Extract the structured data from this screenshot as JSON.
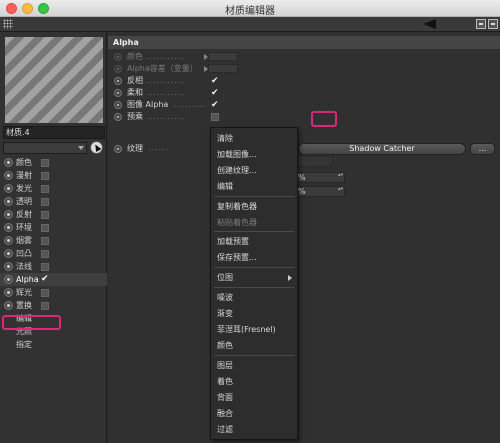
{
  "window": {
    "title": "材质编辑器"
  },
  "material": {
    "name": "材质.4"
  },
  "channels": [
    {
      "label": "颜色",
      "checked": false
    },
    {
      "label": "漫射",
      "checked": false
    },
    {
      "label": "发光",
      "checked": false
    },
    {
      "label": "透明",
      "checked": false
    },
    {
      "label": "反射",
      "checked": false
    },
    {
      "label": "环境",
      "checked": false
    },
    {
      "label": "烟雾",
      "checked": false
    },
    {
      "label": "凹凸",
      "checked": false
    },
    {
      "label": "法线",
      "checked": false
    },
    {
      "label": "Alpha",
      "checked": true
    },
    {
      "label": "辉光",
      "checked": false
    },
    {
      "label": "置换",
      "checked": false
    }
  ],
  "extra_items": [
    "编辑",
    "光照",
    "指定"
  ],
  "section": {
    "title": "Alpha"
  },
  "props": [
    {
      "label": "颜色",
      "dots": "............",
      "type": "field",
      "dim": true
    },
    {
      "label": "Alpha容差（变量）",
      "dots": "",
      "type": "field",
      "dim": true
    },
    {
      "label": "反相",
      "dots": "................",
      "type": "check",
      "value": "✔"
    },
    {
      "label": "柔和",
      "dots": "................",
      "type": "check",
      "value": "✔"
    },
    {
      "label": "图像 Alpha",
      "dots": ".........",
      "type": "check",
      "value": "✔"
    },
    {
      "label": "预乘",
      "dots": "................",
      "type": "box"
    }
  ],
  "texture": {
    "label": "纹理",
    "dots": "......",
    "shader": "Shadow Catcher",
    "more": "..."
  },
  "numeric": [
    {
      "value": "%"
    },
    {
      "value": "%"
    }
  ],
  "menu": {
    "items": [
      {
        "label": "清除",
        "disabled": false
      },
      {
        "label": "加载图像...",
        "disabled": false
      },
      {
        "label": "创建纹理...",
        "disabled": false
      },
      {
        "label": "编辑",
        "disabled": false
      },
      {
        "label": "复制着色器",
        "disabled": false
      },
      {
        "label": "粘贴着色器",
        "disabled": true
      },
      {
        "label": "加载预置",
        "disabled": false
      },
      {
        "label": "保存预置...",
        "disabled": false
      },
      {
        "label": "位图",
        "disabled": false,
        "submenu": true
      },
      {
        "label": "噪波",
        "disabled": false
      },
      {
        "label": "渐变",
        "disabled": false
      },
      {
        "label": "菲涅耳(Fresnel)",
        "disabled": false
      },
      {
        "label": "颜色",
        "disabled": false
      },
      {
        "label": "图层",
        "disabled": false
      },
      {
        "label": "着色",
        "disabled": false
      },
      {
        "label": "背面",
        "disabled": false
      },
      {
        "label": "融合",
        "disabled": false
      },
      {
        "label": "过滤",
        "disabled": false
      }
    ]
  },
  "colors": {
    "highlight": "#e0257a",
    "panel": "#303030"
  }
}
